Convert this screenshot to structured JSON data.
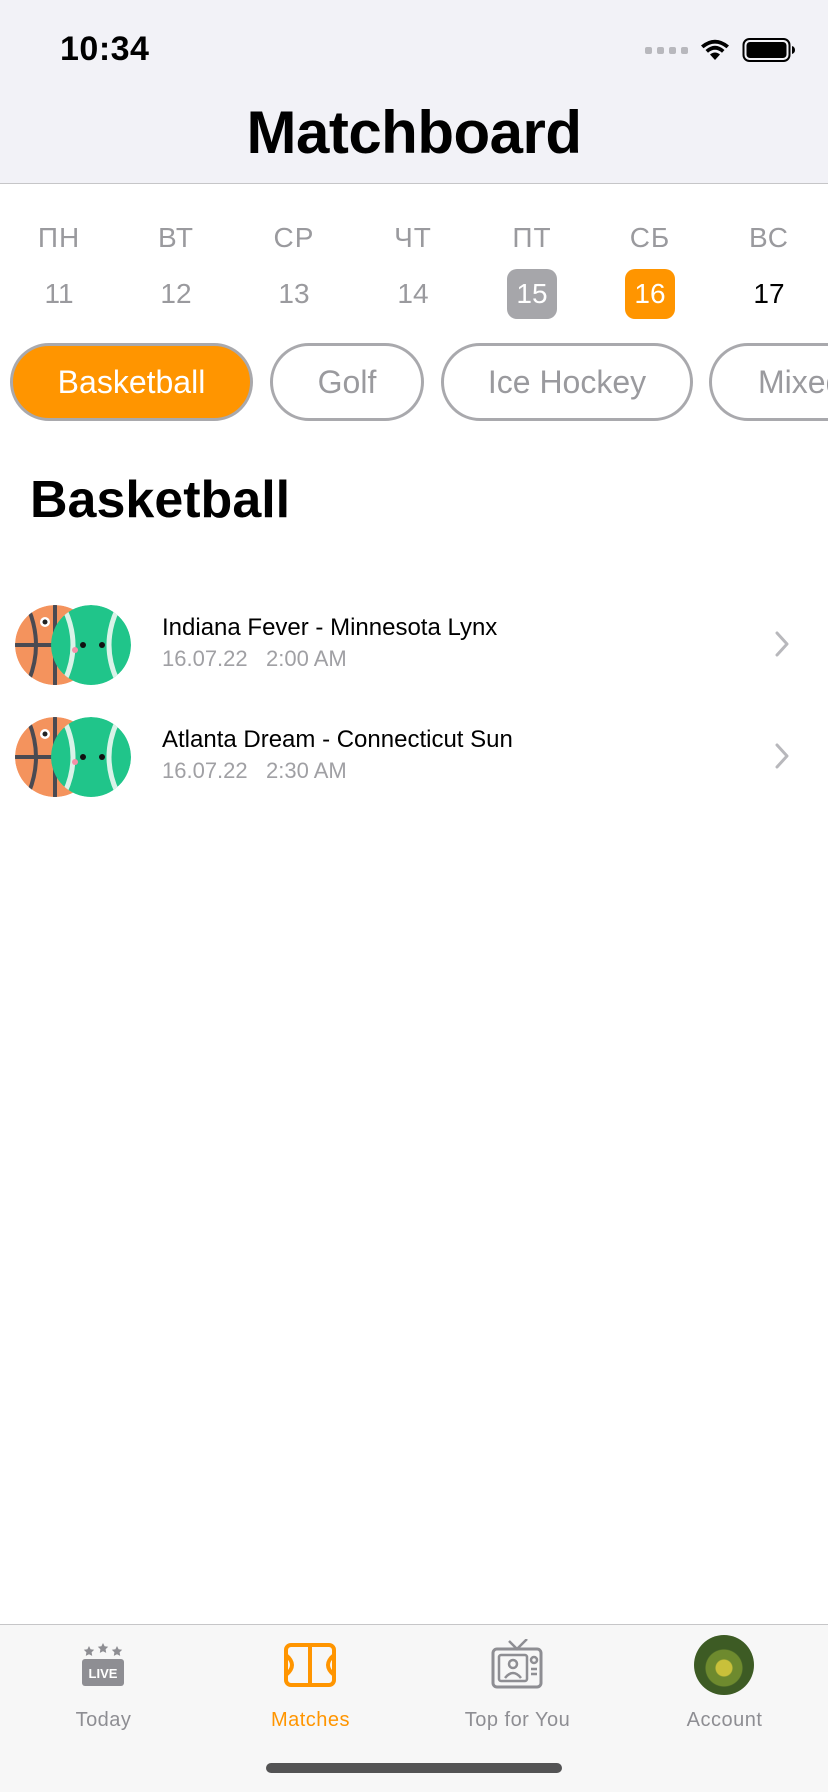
{
  "status_bar": {
    "time": "10:34",
    "icons": [
      "signal-dots-icon",
      "wifi-icon",
      "battery-icon"
    ]
  },
  "nav": {
    "title": "Matchboard"
  },
  "week": {
    "days": [
      {
        "name": "ПН",
        "num": "11",
        "state": "past"
      },
      {
        "name": "ВТ",
        "num": "12",
        "state": "past"
      },
      {
        "name": "СР",
        "num": "13",
        "state": "past"
      },
      {
        "name": "ЧТ",
        "num": "14",
        "state": "past"
      },
      {
        "name": "ПТ",
        "num": "15",
        "state": "past-selected"
      },
      {
        "name": "СБ",
        "num": "16",
        "state": "today"
      },
      {
        "name": "ВС",
        "num": "17",
        "state": "future"
      }
    ]
  },
  "sports": {
    "chips": [
      {
        "label": "Basketball",
        "active": true
      },
      {
        "label": "Golf",
        "active": false
      },
      {
        "label": "Ice Hockey",
        "active": false
      },
      {
        "label": "Mixed",
        "active": false
      }
    ]
  },
  "section": {
    "title": "Basketball"
  },
  "matches": [
    {
      "title": "Indiana Fever - Minnesota Lynx",
      "date": "16.07.22",
      "time": "2:00 AM"
    },
    {
      "title": "Atlanta Dream - Connecticut Sun",
      "date": "16.07.22",
      "time": "2:30 AM"
    }
  ],
  "tabbar": {
    "tabs": [
      {
        "label": "Today",
        "icon": "live-icon",
        "active": false
      },
      {
        "label": "Matches",
        "icon": "court-icon",
        "active": true
      },
      {
        "label": "Top for You",
        "icon": "tv-icon",
        "active": false
      },
      {
        "label": "Account",
        "icon": "avatar-icon",
        "active": false
      }
    ]
  },
  "colors": {
    "accent": "#ff9500",
    "inactive": "#8e8e93",
    "selected_past": "#a6a6aa"
  }
}
